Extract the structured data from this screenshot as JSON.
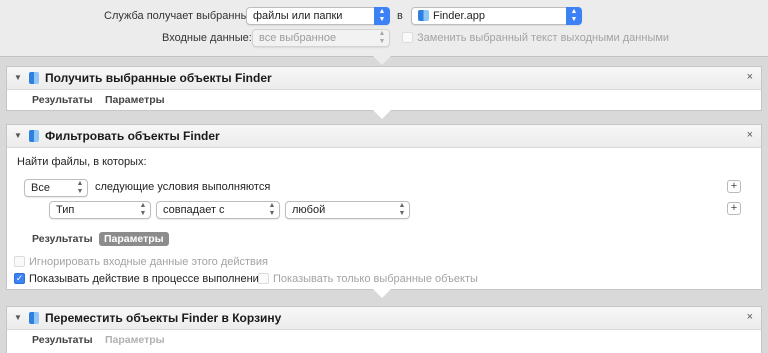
{
  "header": {
    "service_label": "Служба получает выбранные:",
    "service_value": "файлы или папки",
    "in_label": "в",
    "app_value": "Finder.app",
    "input_label": "Входные данные:",
    "input_value": "все выбранное",
    "replace_label": "Заменить выбранный текст выходными данными"
  },
  "action1": {
    "title": "Получить выбранные объекты Finder",
    "tab_results": "Результаты",
    "tab_params": "Параметры"
  },
  "action2": {
    "title": "Фильтровать объекты Finder",
    "find_label": "Найти файлы, в которых:",
    "match_value": "Все",
    "match_text": "следующие условия выполняются",
    "cond_attr": "Тип",
    "cond_op": "совпадает с",
    "cond_value": "любой",
    "tab_results": "Результаты",
    "tab_params": "Параметры",
    "ignore_label": "Игнорировать входные данные этого действия",
    "show_label": "Показывать действие в процессе выполнения",
    "show_only_label": "Показывать только выбранные объекты"
  },
  "action3": {
    "title": "Переместить объекты Finder в Корзину",
    "tab_results": "Результаты",
    "tab_params": "Параметры"
  },
  "icons": {
    "close": "×",
    "plus": "+",
    "checkmark": "✓",
    "disclosure": "▼"
  }
}
